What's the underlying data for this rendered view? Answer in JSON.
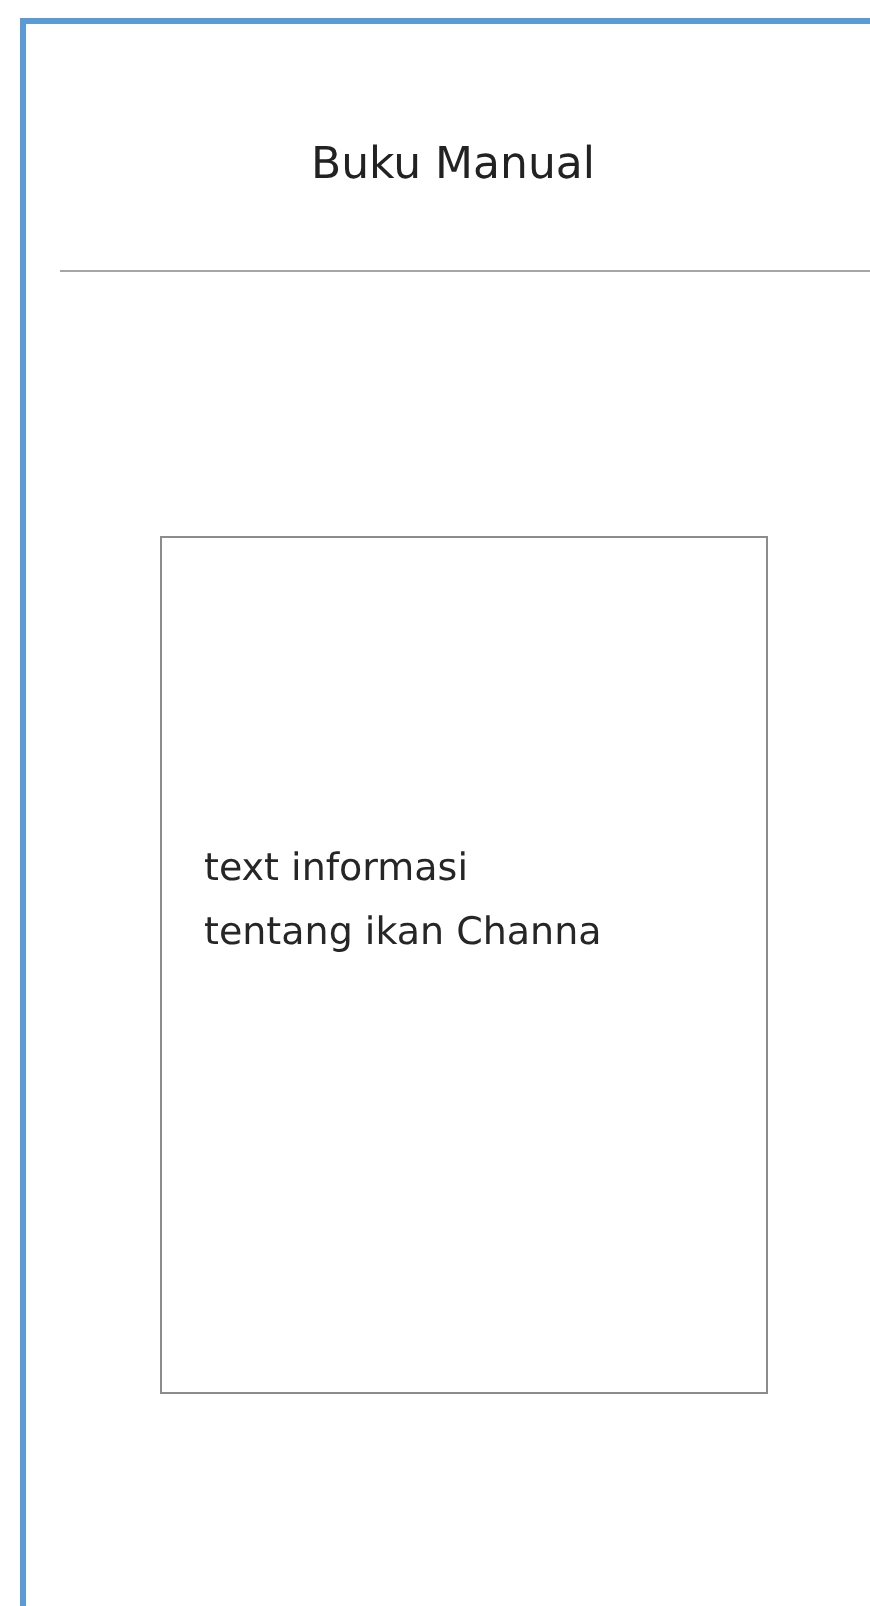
{
  "header": {
    "title": "Buku Manual"
  },
  "info_card": {
    "text": "text informasi\ntentang ikan Channa"
  }
}
